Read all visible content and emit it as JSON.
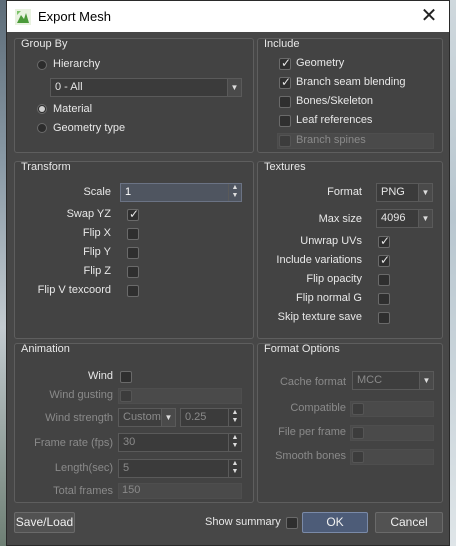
{
  "window": {
    "title": "Export Mesh"
  },
  "group_by": {
    "title": "Group By",
    "hierarchy_label": "Hierarchy",
    "hierarchy_combo": "0 - All",
    "material_label": "Material",
    "geometry_type_label": "Geometry type",
    "selected": "Material"
  },
  "include": {
    "title": "Include",
    "items": [
      {
        "label": "Geometry",
        "checked": true,
        "enabled": true
      },
      {
        "label": "Branch seam blending",
        "checked": true,
        "enabled": true
      },
      {
        "label": "Bones/Skeleton",
        "checked": false,
        "enabled": true
      },
      {
        "label": "Leaf references",
        "checked": false,
        "enabled": true
      },
      {
        "label": "Branch spines",
        "checked": false,
        "enabled": false
      }
    ]
  },
  "transform": {
    "title": "Transform",
    "scale_label": "Scale",
    "scale_value": "1",
    "swap_yz_label": "Swap YZ",
    "swap_yz": true,
    "flip_x_label": "Flip X",
    "flip_x": false,
    "flip_y_label": "Flip Y",
    "flip_y": false,
    "flip_z_label": "Flip Z",
    "flip_z": false,
    "flip_v_label": "Flip V texcoord",
    "flip_v": false
  },
  "textures": {
    "title": "Textures",
    "format_label": "Format",
    "format_value": "PNG",
    "max_size_label": "Max size",
    "max_size_value": "4096",
    "unwrap_uvs_label": "Unwrap UVs",
    "unwrap_uvs": true,
    "include_variations_label": "Include variations",
    "include_variations": true,
    "flip_opacity_label": "Flip opacity",
    "flip_opacity": false,
    "flip_normal_g_label": "Flip normal G",
    "flip_normal_g": false,
    "skip_texture_save_label": "Skip texture save",
    "skip_texture_save": false
  },
  "animation": {
    "title": "Animation",
    "wind_label": "Wind",
    "wind": false,
    "wind_gusting_label": "Wind gusting",
    "wind_strength_label": "Wind strength",
    "wind_strength_mode": "Custom",
    "wind_strength_value": "0.25",
    "frame_rate_label": "Frame rate (fps)",
    "frame_rate_value": "30",
    "length_label": "Length(sec)",
    "length_value": "5",
    "total_frames_label": "Total frames",
    "total_frames_value": "150"
  },
  "format_options": {
    "title": "Format Options",
    "cache_format_label": "Cache format",
    "cache_format_value": "MCC",
    "compatible_label": "Compatible",
    "file_per_frame_label": "File per frame",
    "smooth_bones_label": "Smooth bones"
  },
  "footer": {
    "save_load_label": "Save/Load",
    "show_summary_label": "Show summary",
    "show_summary": false,
    "ok_label": "OK",
    "cancel_label": "Cancel"
  }
}
